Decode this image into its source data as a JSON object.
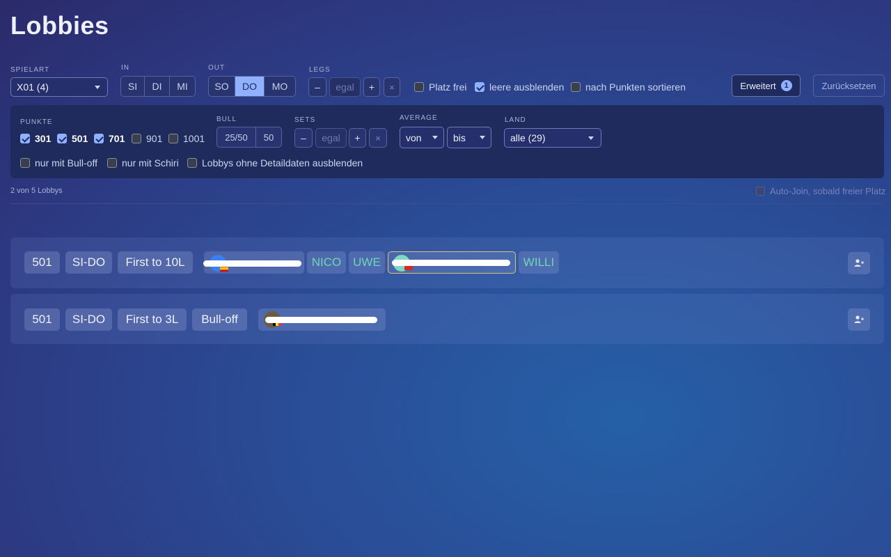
{
  "page": {
    "title": "Lobbies"
  },
  "filters": {
    "spielart": {
      "label": "SPIELART",
      "value": "X01 (4)"
    },
    "in": {
      "label": "IN",
      "options": [
        "SI",
        "DI",
        "MI"
      ]
    },
    "out": {
      "label": "OUT",
      "options": [
        "SO",
        "DO",
        "MO"
      ],
      "selected": "DO"
    },
    "legs": {
      "label": "LEGS",
      "minus": "–",
      "placeholder": "egal",
      "plus": "+",
      "clear": "×"
    },
    "platz_frei": {
      "label": "Platz frei",
      "checked": false
    },
    "leere_ausblenden": {
      "label": "leere ausblenden",
      "checked": true
    },
    "nach_punkten": {
      "label": "nach Punkten sortieren",
      "checked": false
    },
    "erweitert": {
      "label": "Erweitert",
      "badge": "1"
    },
    "reset": {
      "label": "Zurücksetzen"
    }
  },
  "advanced": {
    "punkte": {
      "label": "PUNKTE",
      "options": [
        {
          "label": "301",
          "checked": true
        },
        {
          "label": "501",
          "checked": true
        },
        {
          "label": "701",
          "checked": true
        },
        {
          "label": "901",
          "checked": false
        },
        {
          "label": "1001",
          "checked": false
        }
      ]
    },
    "bull": {
      "label": "BULL",
      "options": [
        "25/50",
        "50"
      ]
    },
    "sets": {
      "label": "SETS",
      "minus": "–",
      "placeholder": "egal",
      "plus": "+",
      "clear": "×"
    },
    "average": {
      "label": "AVERAGE",
      "from": "von",
      "to": "bis"
    },
    "land": {
      "label": "LAND",
      "value": "alle (29)"
    },
    "bull_off": {
      "label": "nur mit Bull-off",
      "checked": false
    },
    "schiri": {
      "label": "nur mit Schiri",
      "checked": false
    },
    "ohne_details": {
      "label": "Lobbys ohne Detaildaten ausblenden",
      "checked": false
    }
  },
  "summary": {
    "count_text": "2 von 5 Lobbys",
    "autojoin_label": "Auto-Join, sobald freier Platz"
  },
  "lobbies": [
    {
      "tags": [
        "501",
        "SI-DO",
        "First to 10L"
      ],
      "players": [
        "NICO",
        "UWE",
        "WILLI"
      ]
    },
    {
      "tags": [
        "501",
        "SI-DO",
        "First to 3L",
        "Bull-off"
      ],
      "players": []
    }
  ],
  "icons": {
    "join": "user-plus-icon",
    "caret": "chevron-down-icon"
  },
  "colors": {
    "accent": "#8fb1ff",
    "player_name": "#6fd6b7",
    "highlight_border": "#d9c57a"
  }
}
